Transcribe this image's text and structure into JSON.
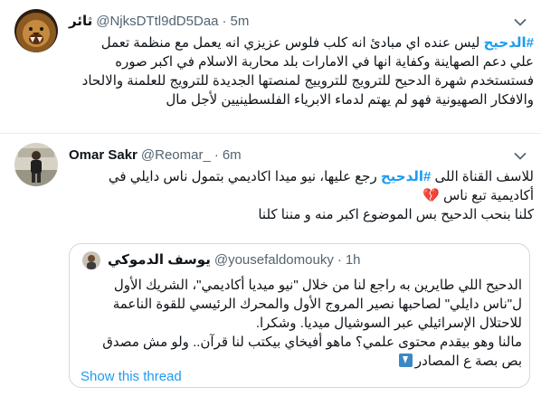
{
  "tweet1": {
    "display_name": "ثائر",
    "handle": "@NjksDTtl9dD5Daa",
    "separator": "·",
    "time": "5m",
    "lines": [
      [
        "#الدحيح",
        " ليس عنده اي مبادئ انه كلب فلوس عزيزي انه يعمل مع منظمة تعمل"
      ],
      [
        "",
        "علي دعم الصهاينة وكفاية انها في الامارات بلد محاربة الاسلام في اكبر صوره"
      ],
      [
        "",
        "فستستخدم شهرة الدحيح للترويج للتروييج لمنصتها الجديدة للترويج للعلمنة والالحاد"
      ],
      [
        "",
        "والافكار الصهيونية فهو لم يهتم لدماء الابرياء الفلسطينيين لأجل مال"
      ]
    ]
  },
  "tweet2": {
    "display_name": "Omar Sakr",
    "handle": "@Reomar_",
    "separator": "·",
    "time": "6m",
    "line1_before": "للاسف القناة اللى ",
    "line1_hashtag": "#الدحيح",
    "line1_after": " رجع عليها، نيو ميدا اكاديمي بتمول ناس دايلي في",
    "line2": "أكاديمية تبع ناس",
    "line2_emoji": "💔",
    "line3": "كلنا بنحب الدحيح بس الموضوع اكبر منه و مننا كلنا"
  },
  "quote": {
    "display_name": "يوسف الدموكي",
    "handle": "@yousefaldomouky",
    "separator": "·",
    "time": "1h",
    "lines": [
      "الدحيح اللي طايرين به راجع لنا من خلال \"نيو ميديا أكاديمي\"، الشريك الأول",
      "ل\"ناس دايلي\" لصاحبها نصير المروج الأول والمحرك الرئيسي للقوة الناعمة",
      "للاحتلال الإسرائيلي عبر السوشيال ميديا. وشكرا.",
      "مالنا وهو بيقدم محتوى علمي؟ ماهو أفيخاي بيكتب لنا قرآن.. ولو مش مصدق",
      "بص بصة ع المصادر"
    ],
    "show_thread": "Show this thread"
  },
  "icons": {
    "caret": "chevron-down-icon",
    "arrow_down_emoji": "arrow-down-emoji-icon"
  },
  "colors": {
    "link_blue": "#1d9bf0",
    "secondary_text": "#536471",
    "border": "#cfd9de",
    "divider": "#e6ecf0"
  }
}
